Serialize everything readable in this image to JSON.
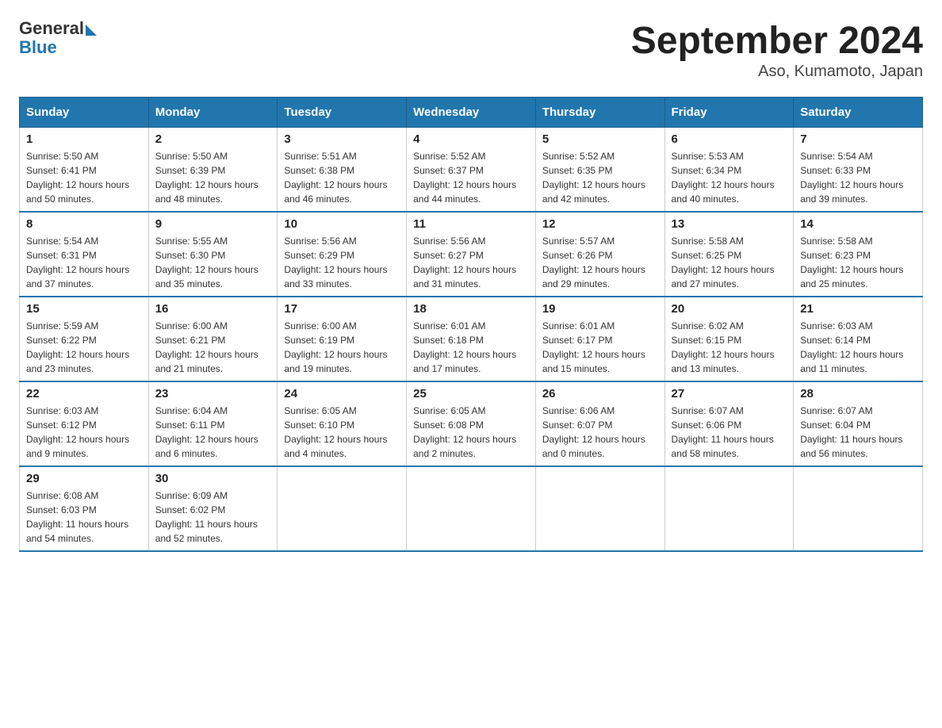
{
  "header": {
    "logo_general": "General",
    "logo_blue": "Blue",
    "title": "September 2024",
    "subtitle": "Aso, Kumamoto, Japan"
  },
  "weekdays": [
    "Sunday",
    "Monday",
    "Tuesday",
    "Wednesday",
    "Thursday",
    "Friday",
    "Saturday"
  ],
  "weeks": [
    [
      {
        "day": "1",
        "sunrise": "5:50 AM",
        "sunset": "6:41 PM",
        "daylight": "12 hours and 50 minutes."
      },
      {
        "day": "2",
        "sunrise": "5:50 AM",
        "sunset": "6:39 PM",
        "daylight": "12 hours and 48 minutes."
      },
      {
        "day": "3",
        "sunrise": "5:51 AM",
        "sunset": "6:38 PM",
        "daylight": "12 hours and 46 minutes."
      },
      {
        "day": "4",
        "sunrise": "5:52 AM",
        "sunset": "6:37 PM",
        "daylight": "12 hours and 44 minutes."
      },
      {
        "day": "5",
        "sunrise": "5:52 AM",
        "sunset": "6:35 PM",
        "daylight": "12 hours and 42 minutes."
      },
      {
        "day": "6",
        "sunrise": "5:53 AM",
        "sunset": "6:34 PM",
        "daylight": "12 hours and 40 minutes."
      },
      {
        "day": "7",
        "sunrise": "5:54 AM",
        "sunset": "6:33 PM",
        "daylight": "12 hours and 39 minutes."
      }
    ],
    [
      {
        "day": "8",
        "sunrise": "5:54 AM",
        "sunset": "6:31 PM",
        "daylight": "12 hours and 37 minutes."
      },
      {
        "day": "9",
        "sunrise": "5:55 AM",
        "sunset": "6:30 PM",
        "daylight": "12 hours and 35 minutes."
      },
      {
        "day": "10",
        "sunrise": "5:56 AM",
        "sunset": "6:29 PM",
        "daylight": "12 hours and 33 minutes."
      },
      {
        "day": "11",
        "sunrise": "5:56 AM",
        "sunset": "6:27 PM",
        "daylight": "12 hours and 31 minutes."
      },
      {
        "day": "12",
        "sunrise": "5:57 AM",
        "sunset": "6:26 PM",
        "daylight": "12 hours and 29 minutes."
      },
      {
        "day": "13",
        "sunrise": "5:58 AM",
        "sunset": "6:25 PM",
        "daylight": "12 hours and 27 minutes."
      },
      {
        "day": "14",
        "sunrise": "5:58 AM",
        "sunset": "6:23 PM",
        "daylight": "12 hours and 25 minutes."
      }
    ],
    [
      {
        "day": "15",
        "sunrise": "5:59 AM",
        "sunset": "6:22 PM",
        "daylight": "12 hours and 23 minutes."
      },
      {
        "day": "16",
        "sunrise": "6:00 AM",
        "sunset": "6:21 PM",
        "daylight": "12 hours and 21 minutes."
      },
      {
        "day": "17",
        "sunrise": "6:00 AM",
        "sunset": "6:19 PM",
        "daylight": "12 hours and 19 minutes."
      },
      {
        "day": "18",
        "sunrise": "6:01 AM",
        "sunset": "6:18 PM",
        "daylight": "12 hours and 17 minutes."
      },
      {
        "day": "19",
        "sunrise": "6:01 AM",
        "sunset": "6:17 PM",
        "daylight": "12 hours and 15 minutes."
      },
      {
        "day": "20",
        "sunrise": "6:02 AM",
        "sunset": "6:15 PM",
        "daylight": "12 hours and 13 minutes."
      },
      {
        "day": "21",
        "sunrise": "6:03 AM",
        "sunset": "6:14 PM",
        "daylight": "12 hours and 11 minutes."
      }
    ],
    [
      {
        "day": "22",
        "sunrise": "6:03 AM",
        "sunset": "6:12 PM",
        "daylight": "12 hours and 9 minutes."
      },
      {
        "day": "23",
        "sunrise": "6:04 AM",
        "sunset": "6:11 PM",
        "daylight": "12 hours and 6 minutes."
      },
      {
        "day": "24",
        "sunrise": "6:05 AM",
        "sunset": "6:10 PM",
        "daylight": "12 hours and 4 minutes."
      },
      {
        "day": "25",
        "sunrise": "6:05 AM",
        "sunset": "6:08 PM",
        "daylight": "12 hours and 2 minutes."
      },
      {
        "day": "26",
        "sunrise": "6:06 AM",
        "sunset": "6:07 PM",
        "daylight": "12 hours and 0 minutes."
      },
      {
        "day": "27",
        "sunrise": "6:07 AM",
        "sunset": "6:06 PM",
        "daylight": "11 hours and 58 minutes."
      },
      {
        "day": "28",
        "sunrise": "6:07 AM",
        "sunset": "6:04 PM",
        "daylight": "11 hours and 56 minutes."
      }
    ],
    [
      {
        "day": "29",
        "sunrise": "6:08 AM",
        "sunset": "6:03 PM",
        "daylight": "11 hours and 54 minutes."
      },
      {
        "day": "30",
        "sunrise": "6:09 AM",
        "sunset": "6:02 PM",
        "daylight": "11 hours and 52 minutes."
      },
      null,
      null,
      null,
      null,
      null
    ]
  ]
}
